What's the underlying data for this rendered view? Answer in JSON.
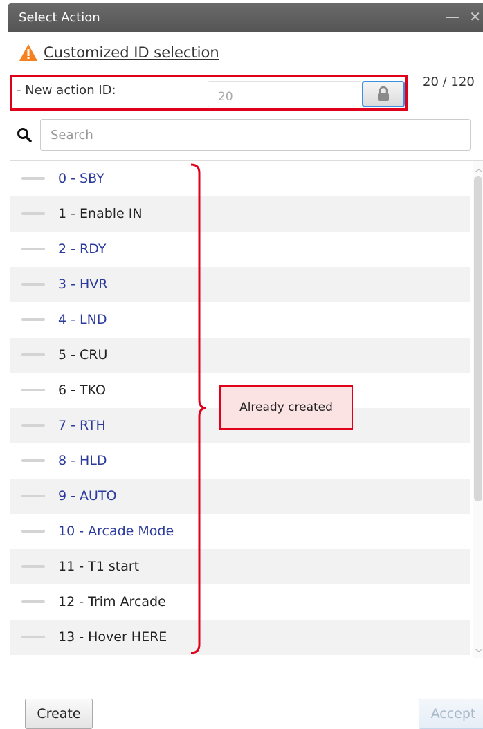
{
  "window": {
    "title": "Select Action",
    "controls": "— ✕"
  },
  "warning": {
    "icon": "warning-triangle-icon",
    "link_text": "Customized ID selection"
  },
  "id_field": {
    "label": "- New action ID:",
    "value": "20",
    "lock_icon": "lock-icon",
    "counter": "20 / 120"
  },
  "search": {
    "placeholder": "Search",
    "icon": "search-icon"
  },
  "actions": [
    {
      "label": "0 - SBY",
      "color": "blue"
    },
    {
      "label": "1 - Enable IN",
      "color": "dark"
    },
    {
      "label": "2 - RDY",
      "color": "blue"
    },
    {
      "label": "3 - HVR",
      "color": "blue"
    },
    {
      "label": "4 - LND",
      "color": "blue"
    },
    {
      "label": "5 - CRU",
      "color": "dark"
    },
    {
      "label": "6 - TKO",
      "color": "dark"
    },
    {
      "label": "7 - RTH",
      "color": "blue"
    },
    {
      "label": "8 - HLD",
      "color": "blue"
    },
    {
      "label": "9 - AUTO",
      "color": "blue"
    },
    {
      "label": "10 - Arcade Mode",
      "color": "blue"
    },
    {
      "label": "11 - T1 start",
      "color": "dark"
    },
    {
      "label": "12 - Trim Arcade",
      "color": "dark"
    },
    {
      "label": "13 - Hover HERE",
      "color": "dark"
    }
  ],
  "annotation": {
    "text": "Already created"
  },
  "footer": {
    "create_label": "Create",
    "accept_label": "Accept"
  },
  "colors": {
    "highlight": "#e0001b",
    "label_blue": "#2b3a9d",
    "lock_border": "#3b90e3"
  }
}
